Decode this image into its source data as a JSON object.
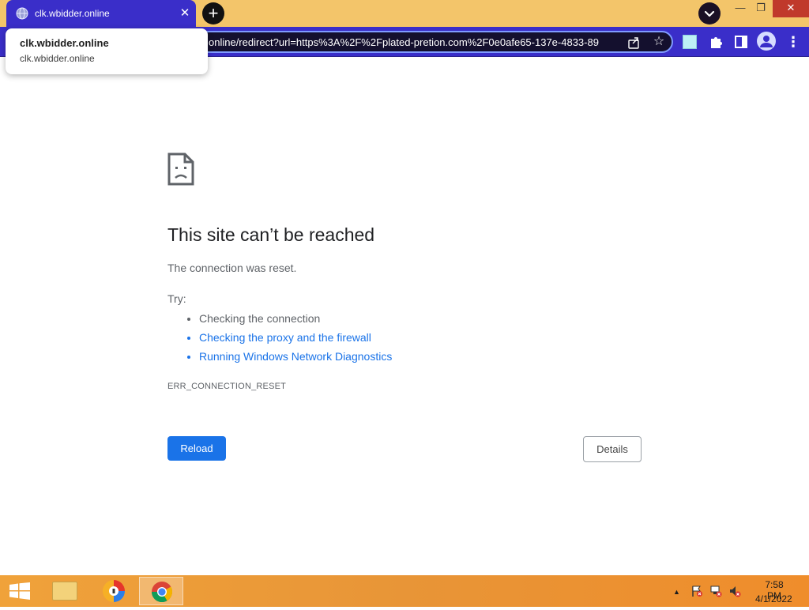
{
  "browser": {
    "tab_title": "clk.wbidder.online",
    "tab_close": "✕",
    "new_tab": "+",
    "url": "online/redirect?url=https%3A%2F%2Fplated-pretion.com%2F0e0afe65-137e-4833-89",
    "window_min": "—",
    "window_max": "❐",
    "window_close": "✕",
    "menu": "⋮",
    "star": "☆"
  },
  "hovercard": {
    "title": "clk.wbidder.online",
    "domain": "clk.wbidder.online"
  },
  "error": {
    "title": "This site can’t be reached",
    "description": "The connection was reset.",
    "try_label": "Try:",
    "suggestions": [
      "Checking the connection",
      "Checking the proxy and the firewall",
      "Running Windows Network Diagnostics"
    ],
    "code": "ERR_CONNECTION_RESET",
    "reload_label": "Reload",
    "details_label": "Details"
  },
  "taskbar": {
    "time": "7:58 PM",
    "date": "4/1/2022",
    "tray_arrow": "▲"
  },
  "colors": {
    "tab_active": "#3a2ec9",
    "tabstrip": "#f3c56a",
    "link": "#1a73e8",
    "reload_button": "#1a73e8",
    "taskbar": "#ef9a35"
  }
}
